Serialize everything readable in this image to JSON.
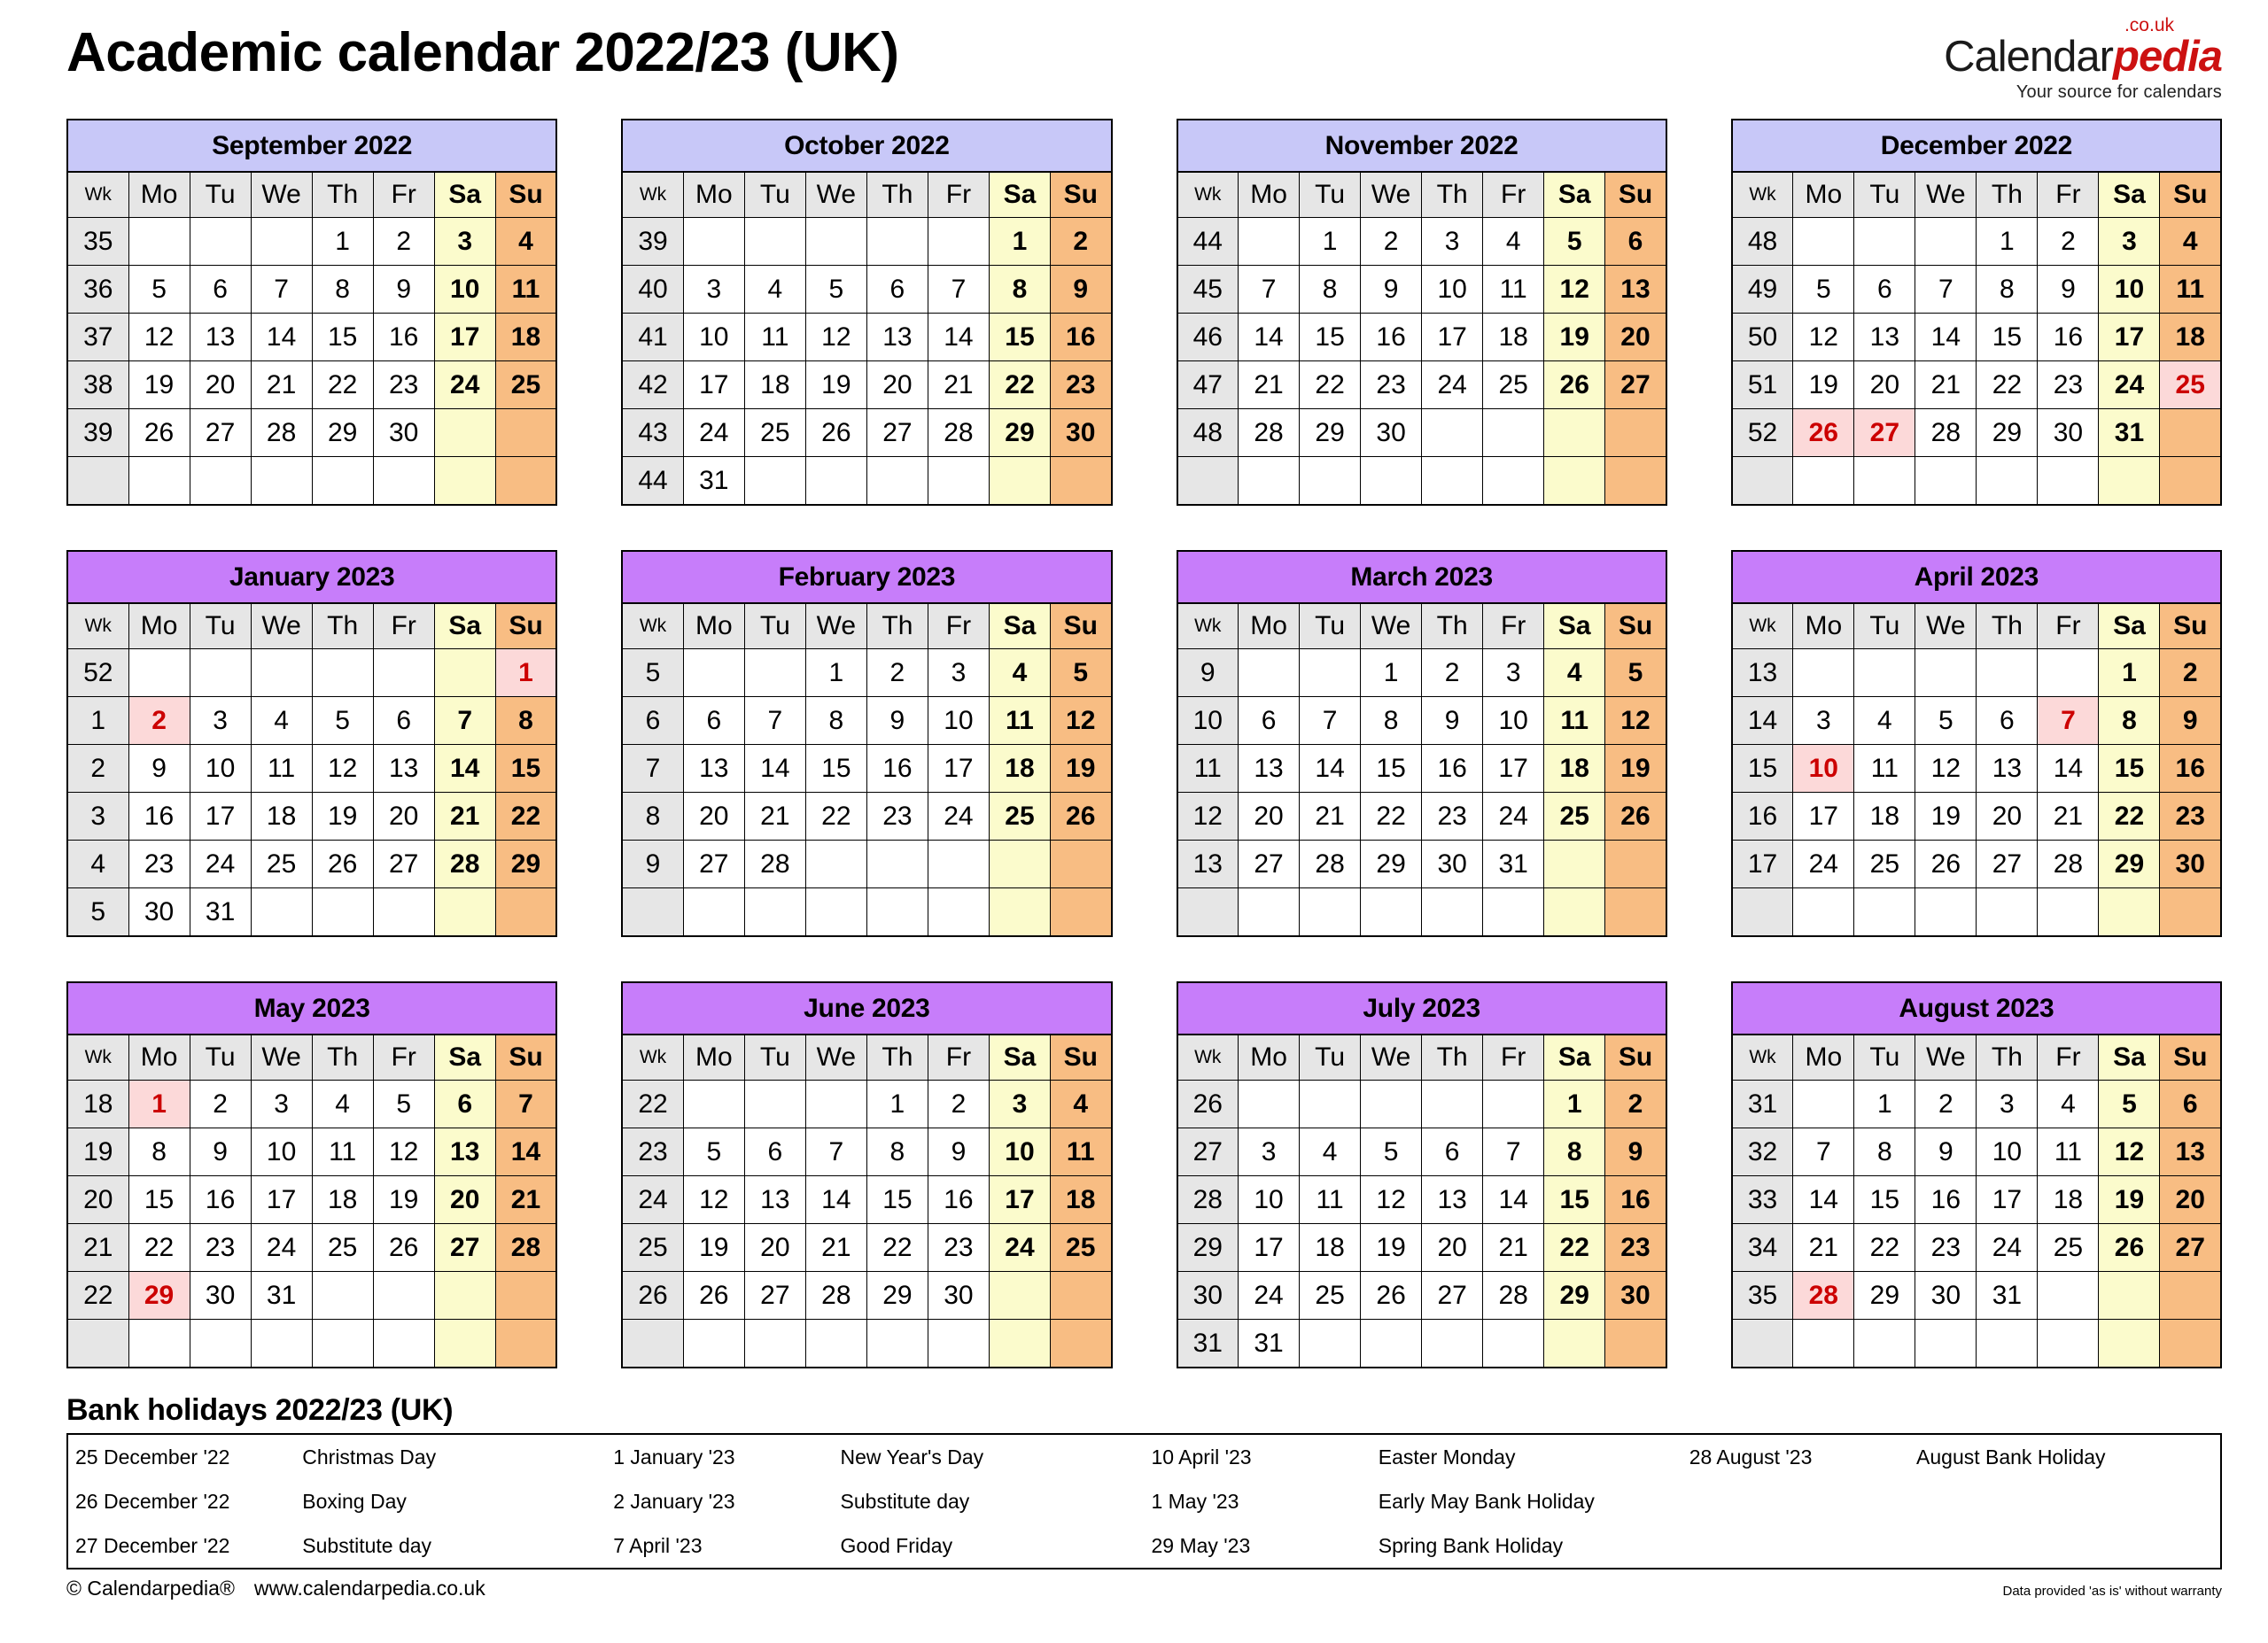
{
  "header": {
    "title": "Academic calendar 2022/23 (UK)",
    "logo_main": "Calendar",
    "logo_accent": "pedia",
    "logo_tld": ".co.uk",
    "logo_tagline": "Your source for calendars"
  },
  "colors": {
    "autumn_header": "#C8C8F8",
    "spring_header": "#C77DFA",
    "saturday": "#FBFBCC",
    "sunday": "#F8BD83",
    "holiday_bg": "#FCD9D9",
    "holiday_text": "#CC0000",
    "dow_bg": "#E6E6E6",
    "logo_accent": "#CC1111"
  },
  "dow_labels": [
    "Wk",
    "Mo",
    "Tu",
    "We",
    "Th",
    "Fr",
    "Sa",
    "Su"
  ],
  "months": [
    {
      "name": "September 2022",
      "season": "autumn",
      "weeks": [
        {
          "wk": "35",
          "days": [
            "",
            "",
            "",
            "1",
            "2",
            "3",
            "4"
          ]
        },
        {
          "wk": "36",
          "days": [
            "5",
            "6",
            "7",
            "8",
            "9",
            "10",
            "11"
          ]
        },
        {
          "wk": "37",
          "days": [
            "12",
            "13",
            "14",
            "15",
            "16",
            "17",
            "18"
          ]
        },
        {
          "wk": "38",
          "days": [
            "19",
            "20",
            "21",
            "22",
            "23",
            "24",
            "25"
          ]
        },
        {
          "wk": "39",
          "days": [
            "26",
            "27",
            "28",
            "29",
            "30",
            "",
            ""
          ]
        },
        {
          "wk": "",
          "days": [
            "",
            "",
            "",
            "",
            "",
            "",
            ""
          ]
        }
      ],
      "holidays": []
    },
    {
      "name": "October 2022",
      "season": "autumn",
      "weeks": [
        {
          "wk": "39",
          "days": [
            "",
            "",
            "",
            "",
            "",
            "1",
            "2"
          ]
        },
        {
          "wk": "40",
          "days": [
            "3",
            "4",
            "5",
            "6",
            "7",
            "8",
            "9"
          ]
        },
        {
          "wk": "41",
          "days": [
            "10",
            "11",
            "12",
            "13",
            "14",
            "15",
            "16"
          ]
        },
        {
          "wk": "42",
          "days": [
            "17",
            "18",
            "19",
            "20",
            "21",
            "22",
            "23"
          ]
        },
        {
          "wk": "43",
          "days": [
            "24",
            "25",
            "26",
            "27",
            "28",
            "29",
            "30"
          ]
        },
        {
          "wk": "44",
          "days": [
            "31",
            "",
            "",
            "",
            "",
            "",
            ""
          ]
        }
      ],
      "holidays": []
    },
    {
      "name": "November 2022",
      "season": "autumn",
      "weeks": [
        {
          "wk": "44",
          "days": [
            "",
            "1",
            "2",
            "3",
            "4",
            "5",
            "6"
          ]
        },
        {
          "wk": "45",
          "days": [
            "7",
            "8",
            "9",
            "10",
            "11",
            "12",
            "13"
          ]
        },
        {
          "wk": "46",
          "days": [
            "14",
            "15",
            "16",
            "17",
            "18",
            "19",
            "20"
          ]
        },
        {
          "wk": "47",
          "days": [
            "21",
            "22",
            "23",
            "24",
            "25",
            "26",
            "27"
          ]
        },
        {
          "wk": "48",
          "days": [
            "28",
            "29",
            "30",
            "",
            "",
            "",
            ""
          ]
        },
        {
          "wk": "",
          "days": [
            "",
            "",
            "",
            "",
            "",
            "",
            ""
          ]
        }
      ],
      "holidays": []
    },
    {
      "name": "December 2022",
      "season": "autumn",
      "weeks": [
        {
          "wk": "48",
          "days": [
            "",
            "",
            "",
            "1",
            "2",
            "3",
            "4"
          ]
        },
        {
          "wk": "49",
          "days": [
            "5",
            "6",
            "7",
            "8",
            "9",
            "10",
            "11"
          ]
        },
        {
          "wk": "50",
          "days": [
            "12",
            "13",
            "14",
            "15",
            "16",
            "17",
            "18"
          ]
        },
        {
          "wk": "51",
          "days": [
            "19",
            "20",
            "21",
            "22",
            "23",
            "24",
            "25"
          ]
        },
        {
          "wk": "52",
          "days": [
            "26",
            "27",
            "28",
            "29",
            "30",
            "31",
            ""
          ]
        },
        {
          "wk": "",
          "days": [
            "",
            "",
            "",
            "",
            "",
            "",
            ""
          ]
        }
      ],
      "holidays": [
        "25",
        "26",
        "27"
      ]
    },
    {
      "name": "January 2023",
      "season": "spring",
      "weeks": [
        {
          "wk": "52",
          "days": [
            "",
            "",
            "",
            "",
            "",
            "",
            "1"
          ]
        },
        {
          "wk": "1",
          "days": [
            "2",
            "3",
            "4",
            "5",
            "6",
            "7",
            "8"
          ]
        },
        {
          "wk": "2",
          "days": [
            "9",
            "10",
            "11",
            "12",
            "13",
            "14",
            "15"
          ]
        },
        {
          "wk": "3",
          "days": [
            "16",
            "17",
            "18",
            "19",
            "20",
            "21",
            "22"
          ]
        },
        {
          "wk": "4",
          "days": [
            "23",
            "24",
            "25",
            "26",
            "27",
            "28",
            "29"
          ]
        },
        {
          "wk": "5",
          "days": [
            "30",
            "31",
            "",
            "",
            "",
            "",
            ""
          ]
        }
      ],
      "holidays": [
        "1",
        "2"
      ]
    },
    {
      "name": "February 2023",
      "season": "spring",
      "weeks": [
        {
          "wk": "5",
          "days": [
            "",
            "",
            "1",
            "2",
            "3",
            "4",
            "5"
          ]
        },
        {
          "wk": "6",
          "days": [
            "6",
            "7",
            "8",
            "9",
            "10",
            "11",
            "12"
          ]
        },
        {
          "wk": "7",
          "days": [
            "13",
            "14",
            "15",
            "16",
            "17",
            "18",
            "19"
          ]
        },
        {
          "wk": "8",
          "days": [
            "20",
            "21",
            "22",
            "23",
            "24",
            "25",
            "26"
          ]
        },
        {
          "wk": "9",
          "days": [
            "27",
            "28",
            "",
            "",
            "",
            "",
            ""
          ]
        },
        {
          "wk": "",
          "days": [
            "",
            "",
            "",
            "",
            "",
            "",
            ""
          ]
        }
      ],
      "holidays": []
    },
    {
      "name": "March 2023",
      "season": "spring",
      "weeks": [
        {
          "wk": "9",
          "days": [
            "",
            "",
            "1",
            "2",
            "3",
            "4",
            "5"
          ]
        },
        {
          "wk": "10",
          "days": [
            "6",
            "7",
            "8",
            "9",
            "10",
            "11",
            "12"
          ]
        },
        {
          "wk": "11",
          "days": [
            "13",
            "14",
            "15",
            "16",
            "17",
            "18",
            "19"
          ]
        },
        {
          "wk": "12",
          "days": [
            "20",
            "21",
            "22",
            "23",
            "24",
            "25",
            "26"
          ]
        },
        {
          "wk": "13",
          "days": [
            "27",
            "28",
            "29",
            "30",
            "31",
            "",
            ""
          ]
        },
        {
          "wk": "",
          "days": [
            "",
            "",
            "",
            "",
            "",
            "",
            ""
          ]
        }
      ],
      "holidays": []
    },
    {
      "name": "April 2023",
      "season": "spring",
      "weeks": [
        {
          "wk": "13",
          "days": [
            "",
            "",
            "",
            "",
            "",
            "1",
            "2"
          ]
        },
        {
          "wk": "14",
          "days": [
            "3",
            "4",
            "5",
            "6",
            "7",
            "8",
            "9"
          ]
        },
        {
          "wk": "15",
          "days": [
            "10",
            "11",
            "12",
            "13",
            "14",
            "15",
            "16"
          ]
        },
        {
          "wk": "16",
          "days": [
            "17",
            "18",
            "19",
            "20",
            "21",
            "22",
            "23"
          ]
        },
        {
          "wk": "17",
          "days": [
            "24",
            "25",
            "26",
            "27",
            "28",
            "29",
            "30"
          ]
        },
        {
          "wk": "",
          "days": [
            "",
            "",
            "",
            "",
            "",
            "",
            ""
          ]
        }
      ],
      "holidays": [
        "7",
        "10"
      ]
    },
    {
      "name": "May 2023",
      "season": "spring",
      "weeks": [
        {
          "wk": "18",
          "days": [
            "1",
            "2",
            "3",
            "4",
            "5",
            "6",
            "7"
          ]
        },
        {
          "wk": "19",
          "days": [
            "8",
            "9",
            "10",
            "11",
            "12",
            "13",
            "14"
          ]
        },
        {
          "wk": "20",
          "days": [
            "15",
            "16",
            "17",
            "18",
            "19",
            "20",
            "21"
          ]
        },
        {
          "wk": "21",
          "days": [
            "22",
            "23",
            "24",
            "25",
            "26",
            "27",
            "28"
          ]
        },
        {
          "wk": "22",
          "days": [
            "29",
            "30",
            "31",
            "",
            "",
            "",
            ""
          ]
        },
        {
          "wk": "",
          "days": [
            "",
            "",
            "",
            "",
            "",
            "",
            ""
          ]
        }
      ],
      "holidays": [
        "1",
        "29"
      ]
    },
    {
      "name": "June 2023",
      "season": "spring",
      "weeks": [
        {
          "wk": "22",
          "days": [
            "",
            "",
            "",
            "1",
            "2",
            "3",
            "4"
          ]
        },
        {
          "wk": "23",
          "days": [
            "5",
            "6",
            "7",
            "8",
            "9",
            "10",
            "11"
          ]
        },
        {
          "wk": "24",
          "days": [
            "12",
            "13",
            "14",
            "15",
            "16",
            "17",
            "18"
          ]
        },
        {
          "wk": "25",
          "days": [
            "19",
            "20",
            "21",
            "22",
            "23",
            "24",
            "25"
          ]
        },
        {
          "wk": "26",
          "days": [
            "26",
            "27",
            "28",
            "29",
            "30",
            "",
            ""
          ]
        },
        {
          "wk": "",
          "days": [
            "",
            "",
            "",
            "",
            "",
            "",
            ""
          ]
        }
      ],
      "holidays": []
    },
    {
      "name": "July 2023",
      "season": "spring",
      "weeks": [
        {
          "wk": "26",
          "days": [
            "",
            "",
            "",
            "",
            "",
            "1",
            "2"
          ]
        },
        {
          "wk": "27",
          "days": [
            "3",
            "4",
            "5",
            "6",
            "7",
            "8",
            "9"
          ]
        },
        {
          "wk": "28",
          "days": [
            "10",
            "11",
            "12",
            "13",
            "14",
            "15",
            "16"
          ]
        },
        {
          "wk": "29",
          "days": [
            "17",
            "18",
            "19",
            "20",
            "21",
            "22",
            "23"
          ]
        },
        {
          "wk": "30",
          "days": [
            "24",
            "25",
            "26",
            "27",
            "28",
            "29",
            "30"
          ]
        },
        {
          "wk": "31",
          "days": [
            "31",
            "",
            "",
            "",
            "",
            "",
            ""
          ]
        }
      ],
      "holidays": []
    },
    {
      "name": "August 2023",
      "season": "spring",
      "weeks": [
        {
          "wk": "31",
          "days": [
            "",
            "1",
            "2",
            "3",
            "4",
            "5",
            "6"
          ]
        },
        {
          "wk": "32",
          "days": [
            "7",
            "8",
            "9",
            "10",
            "11",
            "12",
            "13"
          ]
        },
        {
          "wk": "33",
          "days": [
            "14",
            "15",
            "16",
            "17",
            "18",
            "19",
            "20"
          ]
        },
        {
          "wk": "34",
          "days": [
            "21",
            "22",
            "23",
            "24",
            "25",
            "26",
            "27"
          ]
        },
        {
          "wk": "35",
          "days": [
            "28",
            "29",
            "30",
            "31",
            "",
            "",
            ""
          ]
        },
        {
          "wk": "",
          "days": [
            "",
            "",
            "",
            "",
            "",
            "",
            ""
          ]
        }
      ],
      "holidays": [
        "28"
      ]
    }
  ],
  "bank_holidays": {
    "title": "Bank holidays 2022/23 (UK)",
    "rows": [
      [
        {
          "date": "25 December '22",
          "name": "Christmas Day"
        },
        {
          "date": "1 January '23",
          "name": "New Year's Day"
        },
        {
          "date": "10 April '23",
          "name": "Easter Monday"
        },
        {
          "date": "28 August '23",
          "name": "August Bank Holiday"
        }
      ],
      [
        {
          "date": "26 December '22",
          "name": "Boxing Day"
        },
        {
          "date": "2 January '23",
          "name": "Substitute day"
        },
        {
          "date": "1 May '23",
          "name": "Early May Bank Holiday"
        },
        {
          "date": "",
          "name": ""
        }
      ],
      [
        {
          "date": "27 December '22",
          "name": "Substitute day"
        },
        {
          "date": "7 April '23",
          "name": "Good Friday"
        },
        {
          "date": "29 May '23",
          "name": "Spring Bank Holiday"
        },
        {
          "date": "",
          "name": ""
        }
      ]
    ]
  },
  "footer": {
    "copyright": "© Calendarpedia®",
    "website": "www.calendarpedia.co.uk",
    "warranty": "Data provided 'as is' without warranty"
  }
}
